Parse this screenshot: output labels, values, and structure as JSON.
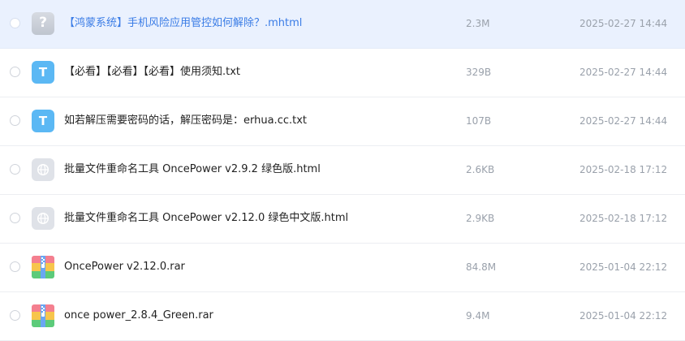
{
  "files": [
    {
      "name": "【鸿蒙系统】手机风险应用管控如何解除？.mhtml",
      "size": "2.3M",
      "date": "2025-02-27 14:44",
      "icon": "unknown-file-icon",
      "icon_glyph": "?",
      "selected": true
    },
    {
      "name": "【必看】【必看】【必看】使用须知.txt",
      "size": "329B",
      "date": "2025-02-27 14:44",
      "icon": "text-file-icon",
      "icon_glyph": "T"
    },
    {
      "name": "如若解压需要密码的话，解压密码是：erhua.cc.txt",
      "size": "107B",
      "date": "2025-02-27 14:44",
      "icon": "text-file-icon",
      "icon_glyph": "T"
    },
    {
      "name": "批量文件重命名工具 OncePower v2.9.2 绿色版.html",
      "size": "2.6KB",
      "date": "2025-02-18 17:12",
      "icon": "html-file-icon"
    },
    {
      "name": "批量文件重命名工具 OncePower v2.12.0 绿色中文版.html",
      "size": "2.9KB",
      "date": "2025-02-18 17:12",
      "icon": "html-file-icon"
    },
    {
      "name": "OncePower v2.12.0.rar",
      "size": "84.8M",
      "date": "2025-01-04 22:12",
      "icon": "archive-file-icon"
    },
    {
      "name": "once power_2.8.4_Green.rar",
      "size": "9.4M",
      "date": "2025-01-04 22:12",
      "icon": "archive-file-icon"
    }
  ],
  "colors": {
    "selected_row": "#eaf1fe",
    "selected_text": "#3a7ce6",
    "txt_icon": "#5bb8f4",
    "meta_text": "#9aa1ab"
  }
}
